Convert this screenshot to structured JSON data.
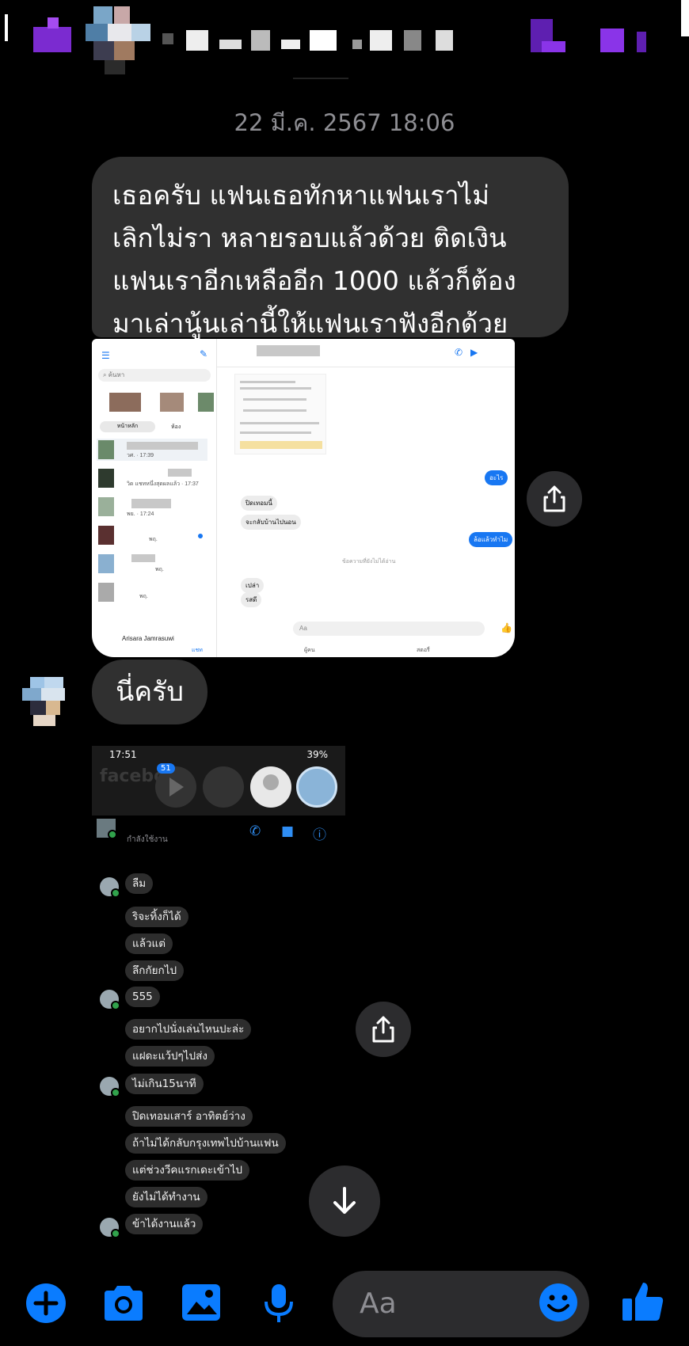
{
  "conversation": {
    "timestamp": "22 มี.ค. 2567 18:06",
    "message_1_lines": [
      "เธอครับ  แฟนเธอทักหาแฟนเราไม่",
      "เลิกไม่รา หลายรอบแล้วด้วย ติดเงิน",
      "แฟนเราอีกเหลืออีก 1000 แล้วก็ต้อง",
      "มาเล่านู้นเล่านี้ให้แฟนเราฟังอีกด้วย"
    ],
    "message_2": "นี่ครับ"
  },
  "screenshot_1": {
    "search_placeholder": "ค้นหา",
    "tab_main": "หน้าหลัก",
    "tab_requests": "ห้อง",
    "row_times": [
      "วศ. · 17:39",
      "วิด แชทหนึ่งสุดผลแล้ว · 17:37",
      "พย. · 17:24",
      "พฤ.",
      "พฤ.",
      "พฤ."
    ],
    "last_contact": "Arisara Jamrasuwi",
    "bubble_outgoing_1": "อะไร",
    "bubble_incoming_1": "ปิดเทอมนี้",
    "bubble_incoming_2": "จะกลับบ้านไปนอน",
    "bubble_outgoing_2": "ล้อแล้วทำไม",
    "divider": "ข้อความที่ยังไม่ได้อ่าน",
    "bubble_incoming_3": "เปล่า",
    "bubble_incoming_4": "รสดี",
    "input_placeholder": "Aa",
    "bottom_tab_chats": "แชท",
    "bottom_tab_people": "ผู้คน",
    "bottom_tab_stories": "สตอรี่"
  },
  "screenshot_2": {
    "status_time": "17:51",
    "status_battery": "39%",
    "brand": "facebo",
    "badge_count": "51",
    "active_status": "กำลังใช้งาน",
    "messages": [
      "ลืม",
      "ริจะทิ้งก็ได้",
      "แล้วแต่",
      "ลึกกัยกไป",
      "555",
      "อยากไปนั่งเล่นไหนปะล่ะ",
      "แฝดะแว้ปๆไปส่ง",
      "ไม่เกิน15นาที",
      "ปิดเทอมเสาร์ อาทิตย์ว่าง",
      "ถ้าไม่ได้กลับกรุงเทพไปบ้านแฟน",
      "แต่ช่วงวีคแรกเดะเข้าไป",
      "ยังไม่ได้ทำงาน",
      "ข้าได้งานแล้ว"
    ]
  },
  "composer": {
    "placeholder": "Aa"
  },
  "colors": {
    "accent": "#0a7cff",
    "bubble": "#303030",
    "timestamp": "#8e8e93"
  },
  "icons": [
    "plus-icon",
    "camera-icon",
    "image-icon",
    "mic-icon",
    "emoji-icon",
    "thumbs-up-icon",
    "share-icon",
    "arrow-down-icon"
  ]
}
